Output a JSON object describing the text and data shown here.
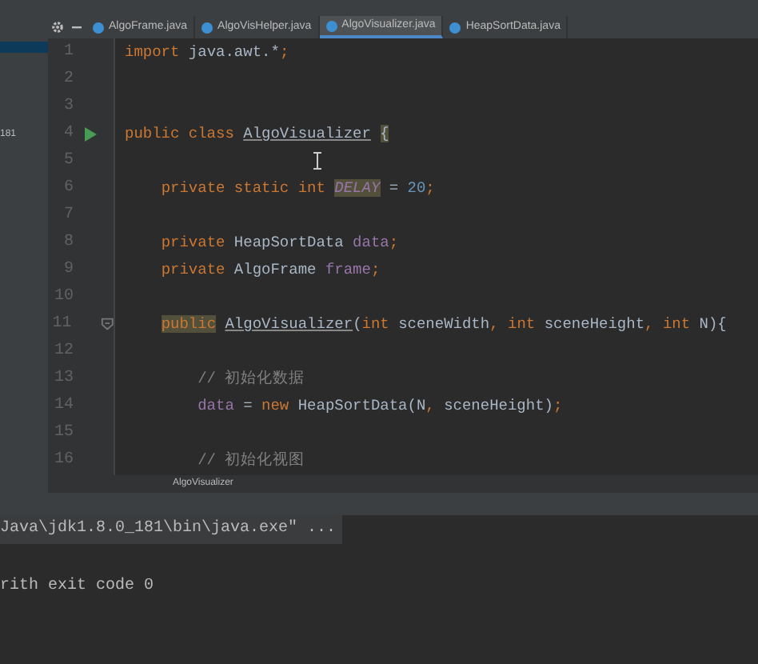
{
  "toolbar": {
    "buttons": [
      {
        "kind": "settings"
      },
      {
        "kind": "collapse"
      }
    ]
  },
  "project_panel": {
    "rows": [
      {
        "selected": true
      },
      {
        "label": "181",
        "selected": false
      }
    ]
  },
  "tabs": [
    {
      "label": "AlgoFrame.java",
      "selected": false
    },
    {
      "label": "AlgoVisHelper.java",
      "selected": false
    },
    {
      "label": "AlgoVisualizer.java",
      "selected": true
    },
    {
      "label": "HeapSortData.java",
      "selected": false
    }
  ],
  "editor": {
    "lines": [
      {
        "number": "1",
        "tokens": [
          {
            "text": "import",
            "kind": "keyword"
          },
          {
            "text": " java.awt.*",
            "kind": "plain"
          },
          {
            "text": ";",
            "kind": "keyword"
          }
        ]
      },
      {
        "number": "2"
      },
      {
        "number": "3"
      },
      {
        "number": "4",
        "runnable": true,
        "tokens": [
          {
            "text": "public class ",
            "kind": "keyword"
          },
          {
            "text": "AlgoVisualizer",
            "kind": "plain",
            "underlined": true
          },
          {
            "text": " {",
            "kind": "plain",
            "highlighted": true
          }
        ]
      },
      {
        "number": "5",
        "caret": true
      },
      {
        "number": "6",
        "tokens": [
          {
            "text": "    private static int ",
            "kind": "keyword"
          },
          {
            "text": "DELAY",
            "kind": "constant",
            "highlighted": true
          },
          {
            "text": " = ",
            "kind": "plain"
          },
          {
            "text": "20",
            "kind": "number"
          },
          {
            "text": ";",
            "kind": "keyword"
          }
        ]
      },
      {
        "number": "7"
      },
      {
        "number": "8",
        "tokens": [
          {
            "text": "    private ",
            "kind": "keyword"
          },
          {
            "text": "HeapSortData ",
            "kind": "plain"
          },
          {
            "text": "data",
            "kind": "field"
          },
          {
            "text": ";",
            "kind": "keyword"
          }
        ]
      },
      {
        "number": "9",
        "tokens": [
          {
            "text": "    private ",
            "kind": "keyword"
          },
          {
            "text": "AlgoFrame ",
            "kind": "plain"
          },
          {
            "text": "frame",
            "kind": "field"
          },
          {
            "text": ";",
            "kind": "keyword"
          }
        ]
      },
      {
        "number": "10"
      },
      {
        "number": "11",
        "foldable": true,
        "tokens": [
          {
            "text": "    public",
            "kind": "keyword",
            "highlighted": true
          },
          {
            "text": " AlgoVisualizer",
            "kind": "plain",
            "underlined": true
          },
          {
            "text": "(",
            "kind": "plain"
          },
          {
            "text": "int ",
            "kind": "keyword"
          },
          {
            "text": "sceneWidth",
            "kind": "plain"
          },
          {
            "text": ", ",
            "kind": "keyword"
          },
          {
            "text": "int ",
            "kind": "keyword"
          },
          {
            "text": "sceneHeight",
            "kind": "plain"
          },
          {
            "text": ", ",
            "kind": "keyword"
          },
          {
            "text": "int ",
            "kind": "keyword"
          },
          {
            "text": "N){",
            "kind": "plain"
          }
        ]
      },
      {
        "number": "12"
      },
      {
        "number": "13",
        "tokens": [
          {
            "text": "        // 初始化数据",
            "kind": "comment"
          }
        ]
      },
      {
        "number": "14",
        "tokens": [
          {
            "text": "        data",
            "kind": "field"
          },
          {
            "text": " = ",
            "kind": "plain"
          },
          {
            "text": "new ",
            "kind": "keyword"
          },
          {
            "text": "HeapSortData(N",
            "kind": "plain"
          },
          {
            "text": ", ",
            "kind": "keyword"
          },
          {
            "text": "sceneHeight)",
            "kind": "plain"
          },
          {
            "text": ";",
            "kind": "keyword"
          }
        ]
      },
      {
        "number": "15"
      },
      {
        "number": "16",
        "tokens": [
          {
            "text": "        // 初始化视图",
            "kind": "comment"
          }
        ]
      }
    ]
  },
  "breadcrumb": "AlgoVisualizer",
  "console": {
    "lines": [
      {
        "text": "Java\\jdk1.8.0_181\\bin\\java.exe\" ...",
        "highlighted": true
      },
      {
        "text": "rith exit code 0",
        "highlighted": false
      }
    ]
  }
}
